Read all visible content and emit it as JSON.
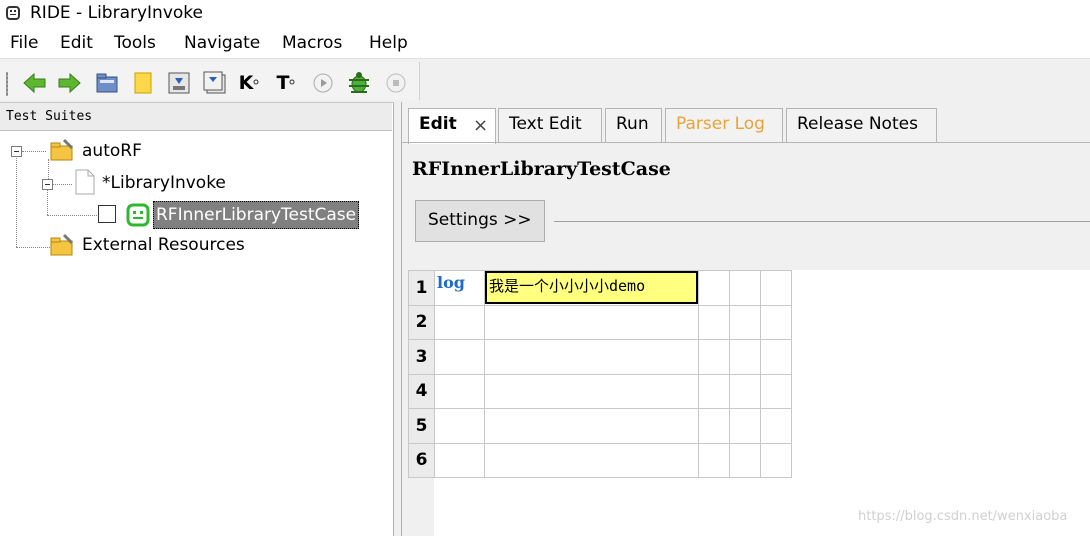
{
  "window": {
    "title": "RIDE - LibraryInvoke",
    "icon": "robot-icon"
  },
  "menu": [
    {
      "label": "File"
    },
    {
      "label": "Edit"
    },
    {
      "label": "Tools"
    },
    {
      "label": "Navigate"
    },
    {
      "label": "Macros"
    },
    {
      "label": "Help"
    }
  ],
  "toolbar": {
    "icons": [
      "back-arrow-icon",
      "forward-arrow-icon",
      "open-folder-icon",
      "open-directory-icon",
      "save-icon",
      "save-all-icon",
      "search-keywords-icon",
      "search-tests-icon",
      "run-icon",
      "debug-bug-icon",
      "stop-icon"
    ],
    "search_keywords_glyph": "K",
    "search_tests_glyph": "T"
  },
  "left_panel": {
    "header": "Test Suites",
    "tree": {
      "root": "autoRF",
      "suite": "*LibraryInvoke",
      "test_case": "RFInnerLibraryTestCase",
      "external": "External Resources"
    }
  },
  "tabs": [
    {
      "label": "Edit",
      "active": true
    },
    {
      "label": "Text Edit",
      "active": false
    },
    {
      "label": "Run",
      "active": false
    },
    {
      "label": "Parser Log",
      "active": false,
      "color": "#e8a33a"
    },
    {
      "label": "Release Notes",
      "active": false
    }
  ],
  "editor": {
    "testcase_name": "RFInnerLibraryTestCase",
    "settings_button": "Settings >>",
    "rows": [
      {
        "num": "1",
        "keyword": "log",
        "arg": "我是一个小小小小demo"
      },
      {
        "num": "2",
        "keyword": "",
        "arg": ""
      },
      {
        "num": "3",
        "keyword": "",
        "arg": ""
      },
      {
        "num": "4",
        "keyword": "",
        "arg": ""
      },
      {
        "num": "5",
        "keyword": "",
        "arg": ""
      },
      {
        "num": "6",
        "keyword": "",
        "arg": ""
      }
    ]
  },
  "watermark": "https://blog.csdn.net/wenxiaoba",
  "colors": {
    "keyword": "#1d6cc7",
    "selected_cell": "#ffff80",
    "parser_log": "#e8a33a",
    "selected_tree_item": "#808080",
    "testcase_icon": "#2eb82e"
  }
}
